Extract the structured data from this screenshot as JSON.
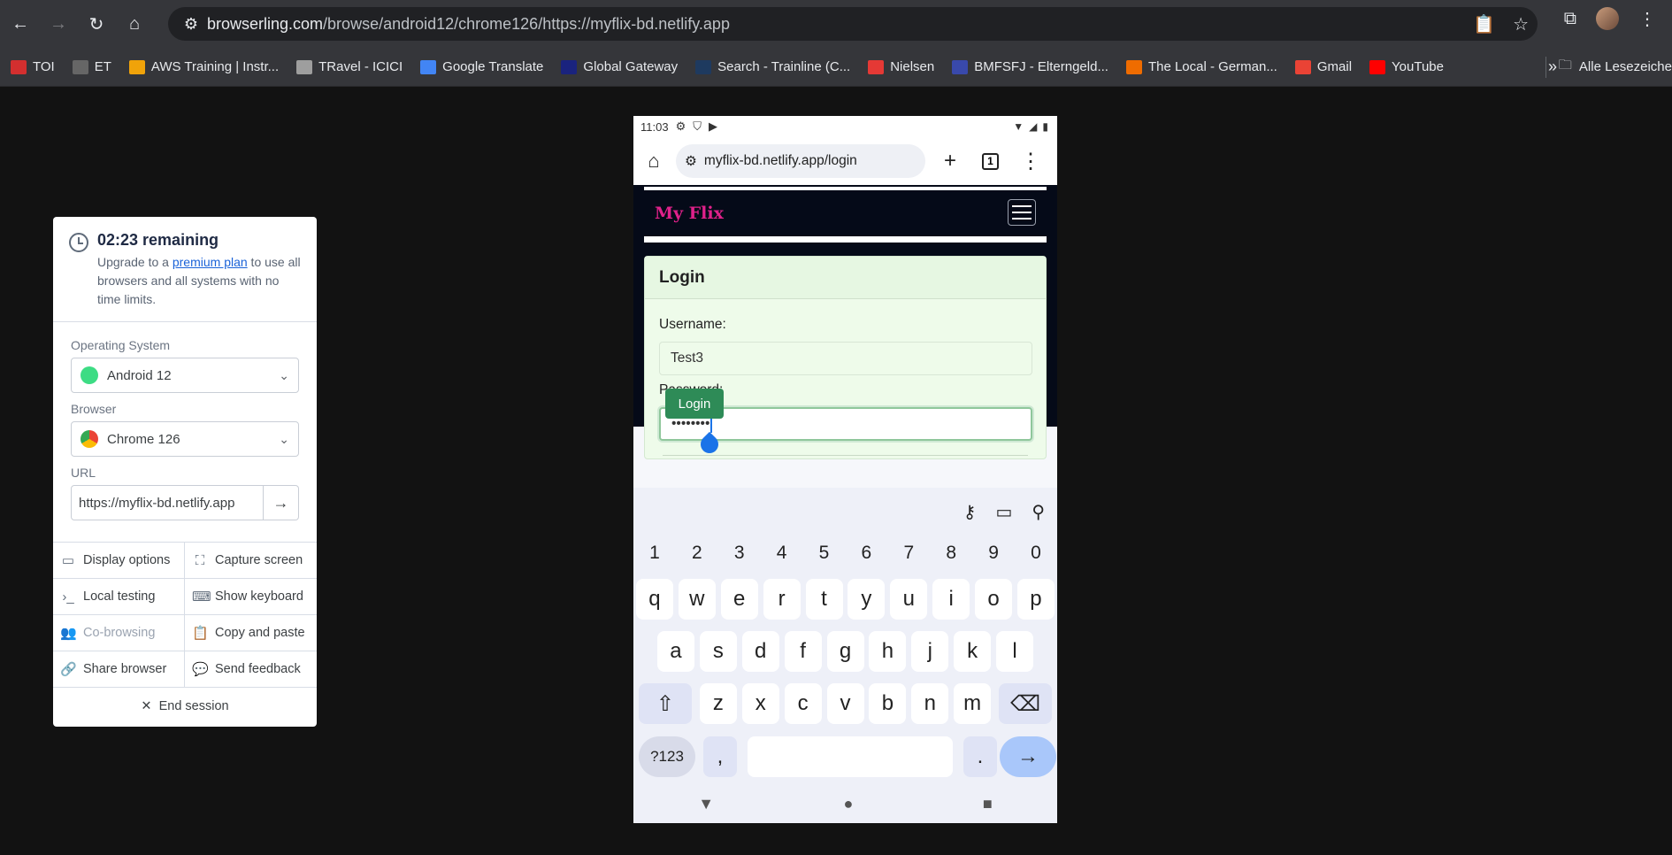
{
  "browser": {
    "url_host": "browserling.com",
    "url_path": "/browse/android12/chrome126/https://myflix-bd.netlify.app",
    "bookmarks": [
      {
        "label": "TOI",
        "color": "#d32f2f",
        "icon": "toi-icon"
      },
      {
        "label": "ET",
        "color": "#666666",
        "icon": "et-icon"
      },
      {
        "label": "AWS Training | Instr...",
        "color": "#f0a30a",
        "icon": "aws-icon"
      },
      {
        "label": "TRavel - ICICI",
        "color": "#9e9e9e",
        "icon": "globe-icon"
      },
      {
        "label": "Google Translate",
        "color": "#4285f4",
        "icon": "translate-icon"
      },
      {
        "label": "Global Gateway",
        "color": "#1a237e",
        "icon": "zeiss-icon"
      },
      {
        "label": "Search - Trainline (C...",
        "color": "#1e3a5f",
        "icon": "trainline-icon"
      },
      {
        "label": "Nielsen",
        "color": "#e53935",
        "icon": "nielsen-icon"
      },
      {
        "label": "BMFSFJ - Elterngeld...",
        "color": "#3949ab",
        "icon": "bmfsfj-icon"
      },
      {
        "label": "The Local - German...",
        "color": "#ef6c00",
        "icon": "thelocal-icon"
      },
      {
        "label": "Gmail",
        "color": "#ea4335",
        "icon": "gmail-icon"
      },
      {
        "label": "YouTube",
        "color": "#ff0000",
        "icon": "youtube-icon"
      }
    ],
    "bookmarks_folder": "Alle Lesezeiche"
  },
  "panel": {
    "remaining": "02:23 remaining",
    "upgrade_pre": "Upgrade to a ",
    "upgrade_link": "premium plan",
    "upgrade_post": " to use all browsers and all systems with no time limits.",
    "os_label": "Operating System",
    "os_value": "Android 12",
    "browser_label": "Browser",
    "browser_value": "Chrome 126",
    "url_label": "URL",
    "url_value": "https://myflix-bd.netlify.app",
    "actions": [
      {
        "label": "Display options",
        "icon": "monitor-icon",
        "symbol": "▭",
        "disabled": false
      },
      {
        "label": "Capture screen",
        "icon": "capture-icon",
        "symbol": "⛶",
        "disabled": false
      },
      {
        "label": "Local testing",
        "icon": "terminal-icon",
        "symbol": "›_",
        "disabled": false
      },
      {
        "label": "Show keyboard",
        "icon": "keyboard-icon",
        "symbol": "⌨",
        "disabled": false
      },
      {
        "label": "Co-browsing",
        "icon": "users-icon",
        "symbol": "👥",
        "disabled": true
      },
      {
        "label": "Copy and paste",
        "icon": "clipboard-icon",
        "symbol": "📋",
        "disabled": false
      },
      {
        "label": "Share browser",
        "icon": "link-icon",
        "symbol": "🔗",
        "disabled": false
      },
      {
        "label": "Send feedback",
        "icon": "feedback-icon",
        "symbol": "💬",
        "disabled": false
      }
    ],
    "end_session": "End session"
  },
  "phone": {
    "time": "11:03",
    "url": "myflix-bd.netlify.app/login",
    "tab_count": "1",
    "brand": "My Flix",
    "login_title": "Login",
    "username_label": "Username:",
    "username_value": "Test3",
    "password_label": "Password:",
    "password_value": "••••••••",
    "login_button": "Login",
    "keyboard": {
      "numbers": [
        "1",
        "2",
        "3",
        "4",
        "5",
        "6",
        "7",
        "8",
        "9",
        "0"
      ],
      "row1": [
        "q",
        "w",
        "e",
        "r",
        "t",
        "y",
        "u",
        "i",
        "o",
        "p"
      ],
      "row2": [
        "a",
        "s",
        "d",
        "f",
        "g",
        "h",
        "j",
        "k",
        "l"
      ],
      "row3": [
        "z",
        "x",
        "c",
        "v",
        "b",
        "n",
        "m"
      ],
      "sym_key": "?123",
      "comma": ",",
      "period": "."
    }
  }
}
